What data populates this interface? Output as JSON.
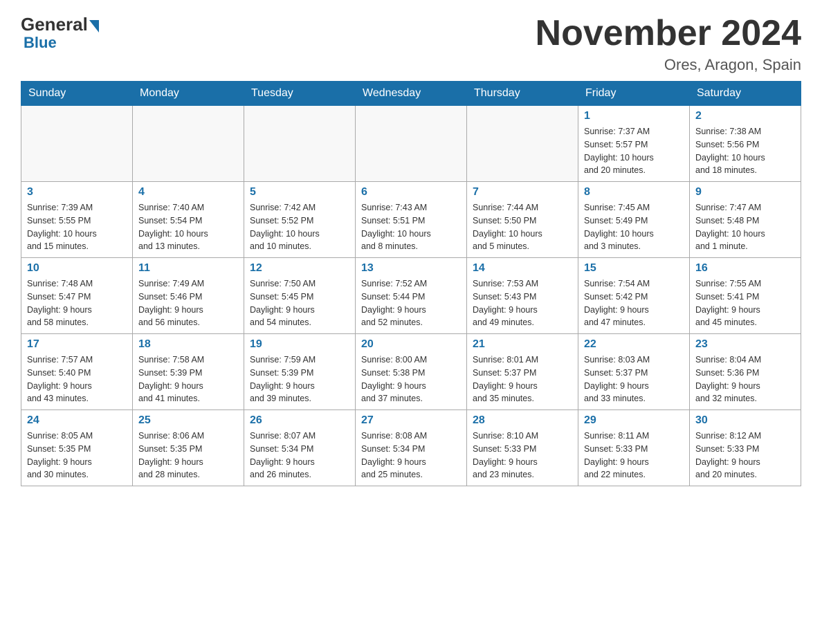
{
  "header": {
    "title": "November 2024",
    "location": "Ores, Aragon, Spain",
    "logo_general": "General",
    "logo_blue": "Blue"
  },
  "weekdays": [
    "Sunday",
    "Monday",
    "Tuesday",
    "Wednesday",
    "Thursday",
    "Friday",
    "Saturday"
  ],
  "weeks": [
    [
      {
        "day": "",
        "info": ""
      },
      {
        "day": "",
        "info": ""
      },
      {
        "day": "",
        "info": ""
      },
      {
        "day": "",
        "info": ""
      },
      {
        "day": "",
        "info": ""
      },
      {
        "day": "1",
        "info": "Sunrise: 7:37 AM\nSunset: 5:57 PM\nDaylight: 10 hours\nand 20 minutes."
      },
      {
        "day": "2",
        "info": "Sunrise: 7:38 AM\nSunset: 5:56 PM\nDaylight: 10 hours\nand 18 minutes."
      }
    ],
    [
      {
        "day": "3",
        "info": "Sunrise: 7:39 AM\nSunset: 5:55 PM\nDaylight: 10 hours\nand 15 minutes."
      },
      {
        "day": "4",
        "info": "Sunrise: 7:40 AM\nSunset: 5:54 PM\nDaylight: 10 hours\nand 13 minutes."
      },
      {
        "day": "5",
        "info": "Sunrise: 7:42 AM\nSunset: 5:52 PM\nDaylight: 10 hours\nand 10 minutes."
      },
      {
        "day": "6",
        "info": "Sunrise: 7:43 AM\nSunset: 5:51 PM\nDaylight: 10 hours\nand 8 minutes."
      },
      {
        "day": "7",
        "info": "Sunrise: 7:44 AM\nSunset: 5:50 PM\nDaylight: 10 hours\nand 5 minutes."
      },
      {
        "day": "8",
        "info": "Sunrise: 7:45 AM\nSunset: 5:49 PM\nDaylight: 10 hours\nand 3 minutes."
      },
      {
        "day": "9",
        "info": "Sunrise: 7:47 AM\nSunset: 5:48 PM\nDaylight: 10 hours\nand 1 minute."
      }
    ],
    [
      {
        "day": "10",
        "info": "Sunrise: 7:48 AM\nSunset: 5:47 PM\nDaylight: 9 hours\nand 58 minutes."
      },
      {
        "day": "11",
        "info": "Sunrise: 7:49 AM\nSunset: 5:46 PM\nDaylight: 9 hours\nand 56 minutes."
      },
      {
        "day": "12",
        "info": "Sunrise: 7:50 AM\nSunset: 5:45 PM\nDaylight: 9 hours\nand 54 minutes."
      },
      {
        "day": "13",
        "info": "Sunrise: 7:52 AM\nSunset: 5:44 PM\nDaylight: 9 hours\nand 52 minutes."
      },
      {
        "day": "14",
        "info": "Sunrise: 7:53 AM\nSunset: 5:43 PM\nDaylight: 9 hours\nand 49 minutes."
      },
      {
        "day": "15",
        "info": "Sunrise: 7:54 AM\nSunset: 5:42 PM\nDaylight: 9 hours\nand 47 minutes."
      },
      {
        "day": "16",
        "info": "Sunrise: 7:55 AM\nSunset: 5:41 PM\nDaylight: 9 hours\nand 45 minutes."
      }
    ],
    [
      {
        "day": "17",
        "info": "Sunrise: 7:57 AM\nSunset: 5:40 PM\nDaylight: 9 hours\nand 43 minutes."
      },
      {
        "day": "18",
        "info": "Sunrise: 7:58 AM\nSunset: 5:39 PM\nDaylight: 9 hours\nand 41 minutes."
      },
      {
        "day": "19",
        "info": "Sunrise: 7:59 AM\nSunset: 5:39 PM\nDaylight: 9 hours\nand 39 minutes."
      },
      {
        "day": "20",
        "info": "Sunrise: 8:00 AM\nSunset: 5:38 PM\nDaylight: 9 hours\nand 37 minutes."
      },
      {
        "day": "21",
        "info": "Sunrise: 8:01 AM\nSunset: 5:37 PM\nDaylight: 9 hours\nand 35 minutes."
      },
      {
        "day": "22",
        "info": "Sunrise: 8:03 AM\nSunset: 5:37 PM\nDaylight: 9 hours\nand 33 minutes."
      },
      {
        "day": "23",
        "info": "Sunrise: 8:04 AM\nSunset: 5:36 PM\nDaylight: 9 hours\nand 32 minutes."
      }
    ],
    [
      {
        "day": "24",
        "info": "Sunrise: 8:05 AM\nSunset: 5:35 PM\nDaylight: 9 hours\nand 30 minutes."
      },
      {
        "day": "25",
        "info": "Sunrise: 8:06 AM\nSunset: 5:35 PM\nDaylight: 9 hours\nand 28 minutes."
      },
      {
        "day": "26",
        "info": "Sunrise: 8:07 AM\nSunset: 5:34 PM\nDaylight: 9 hours\nand 26 minutes."
      },
      {
        "day": "27",
        "info": "Sunrise: 8:08 AM\nSunset: 5:34 PM\nDaylight: 9 hours\nand 25 minutes."
      },
      {
        "day": "28",
        "info": "Sunrise: 8:10 AM\nSunset: 5:33 PM\nDaylight: 9 hours\nand 23 minutes."
      },
      {
        "day": "29",
        "info": "Sunrise: 8:11 AM\nSunset: 5:33 PM\nDaylight: 9 hours\nand 22 minutes."
      },
      {
        "day": "30",
        "info": "Sunrise: 8:12 AM\nSunset: 5:33 PM\nDaylight: 9 hours\nand 20 minutes."
      }
    ]
  ]
}
